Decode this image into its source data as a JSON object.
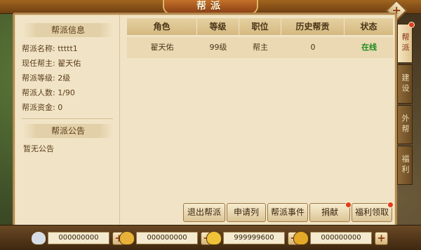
{
  "window": {
    "title": "帮派",
    "close_label": "+"
  },
  "guild_info": {
    "heading": "帮派信息",
    "name_label": "帮派名称:",
    "name_value": "ttttt1",
    "leader_label": "现任帮主:",
    "leader_value": "翟天佑",
    "level_label": "帮派等级:",
    "level_value": "2级",
    "members_label": "帮派人数:",
    "members_value": "1/90",
    "funds_label": "帮派资金:",
    "funds_value": "0"
  },
  "announcement": {
    "heading": "帮派公告",
    "text": "暂无公告"
  },
  "member_table": {
    "columns": [
      "角色",
      "等级",
      "职位",
      "历史帮贡",
      "状态"
    ],
    "rows": [
      {
        "name": "翟天佑",
        "level": "99级",
        "position": "帮主",
        "contribution": "0",
        "status": "在线"
      }
    ]
  },
  "actions": {
    "quit": "退出帮派",
    "applications": "申请列表",
    "events": "帮派事件",
    "donate": "捐献",
    "welfare": "福利领取"
  },
  "tabs": [
    {
      "label": "帮派",
      "active": true,
      "badge": true
    },
    {
      "label": "建设",
      "active": false,
      "badge": false
    },
    {
      "label": "外帮",
      "active": false,
      "badge": false
    },
    {
      "label": "福利",
      "active": false,
      "badge": false
    }
  ],
  "currencies": [
    {
      "icon": "silver-ingot-icon",
      "amount": "000000000",
      "color": "#d7dde6"
    },
    {
      "icon": "gold-coin-icon",
      "amount": "000000000",
      "color": "#e8b23a"
    },
    {
      "icon": "gold-ingot-icon",
      "amount": "999999600",
      "color": "#f0c23a"
    },
    {
      "icon": "gold-sycee-icon",
      "amount": "000000000",
      "color": "#e5a92a"
    }
  ],
  "plus_label": "+"
}
